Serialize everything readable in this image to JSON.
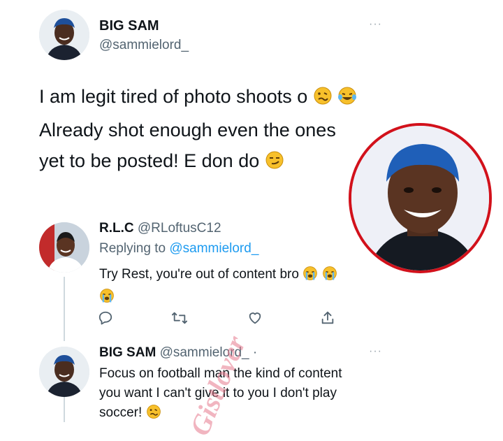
{
  "tweet": {
    "display_name": "BIG SAM",
    "handle": "@sammielord_",
    "more_label": "···",
    "text_lines": [
      "I am legit tired of photo shoots o",
      "Already shot enough even the ones",
      "yet to be posted! E don do"
    ]
  },
  "reply1": {
    "display_name": "R.L.C",
    "handle": "@RLoftusC12",
    "replying_prefix": "Replying to",
    "replying_handle": "@sammielord_",
    "text": "Try Rest, you're out of content bro"
  },
  "actions": [
    "reply-icon",
    "retweet-icon",
    "like-icon",
    "share-icon"
  ],
  "reply2": {
    "display_name": "BIG SAM",
    "handle": "@sammielord_",
    "separator": "·",
    "more_label": "···",
    "text_lines": [
      "Focus on football man the kind of content",
      "you want I can't give it to you I don't play",
      "soccer!"
    ]
  },
  "watermark": "Gistlover",
  "colors": {
    "accent_link": "#1d9bf0",
    "circle_border": "#d2111b",
    "thread_line": "#cfd9de",
    "emoji_yellow": "#f7c02b"
  }
}
